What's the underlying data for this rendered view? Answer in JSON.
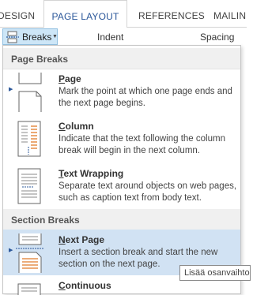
{
  "tabs": [
    "DESIGN",
    "PAGE LAYOUT",
    "REFERENCES",
    "MAILIN"
  ],
  "ribbon": {
    "breaks_label": "Breaks",
    "indent_label": "Indent",
    "spacing_label": "Spacing"
  },
  "menu": {
    "sections": [
      {
        "title": "Page Breaks"
      },
      {
        "title": "Section Breaks"
      }
    ],
    "items": [
      {
        "accel": "P",
        "rest": "age",
        "desc": "Mark the point at which one page ends and the next page begins."
      },
      {
        "accel": "C",
        "rest": "olumn",
        "desc": "Indicate that the text following the column break will begin in the next column."
      },
      {
        "accel": "T",
        "rest": "ext Wrapping",
        "desc": "Separate text around objects on web pages, such as caption text from body text."
      },
      {
        "accel": "N",
        "rest": "ext Page",
        "desc": "Insert a section break and start the new section on the next page."
      },
      {
        "accel": "C",
        "rest": "ontinuous",
        "desc": ""
      }
    ]
  },
  "tooltip": "Lisää osanvaihto",
  "colors": {
    "accent": "#2b579a",
    "hover": "#d1e2f3",
    "button": "#cde6f7",
    "icon_orange": "#e07b2a"
  }
}
